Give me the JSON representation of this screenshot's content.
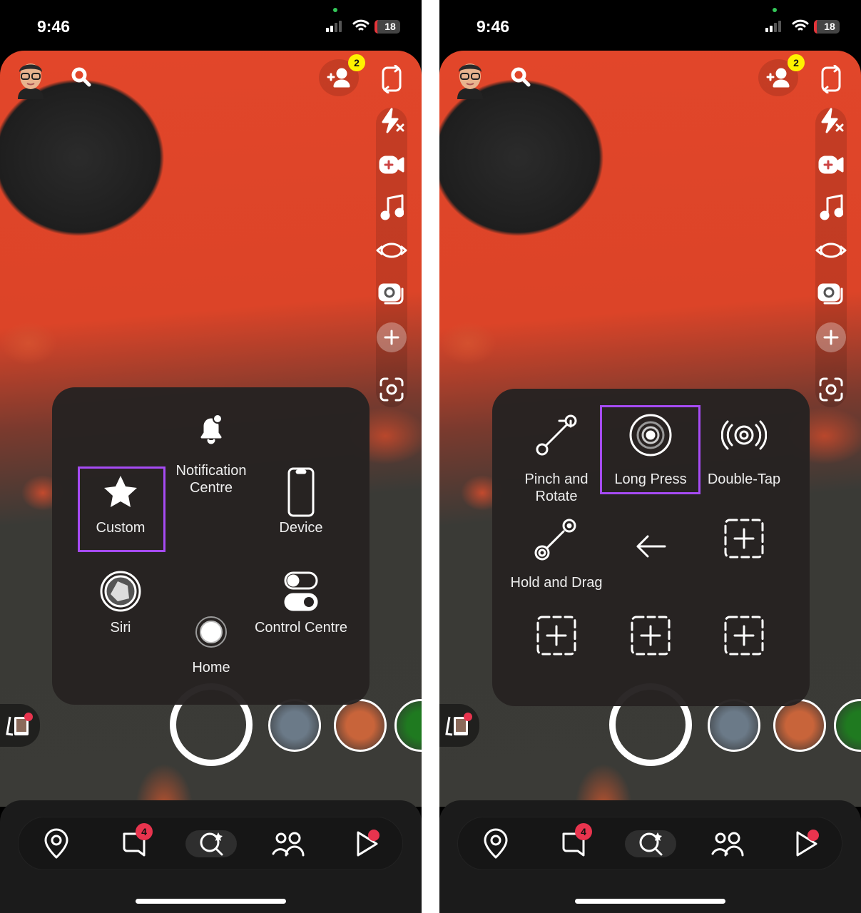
{
  "screens": [
    {
      "status": {
        "time": "9:46",
        "battery": "18"
      },
      "friends_badge": "2",
      "chat_badge": "4",
      "menu": {
        "items": [
          {
            "label": "Notification Centre",
            "icon": "bell-icon"
          },
          {
            "label": "Custom",
            "icon": "star-icon",
            "highlighted": true
          },
          {
            "label": "Device",
            "icon": "phone-device-icon"
          },
          {
            "label": "Siri",
            "icon": "siri-icon"
          },
          {
            "label": "Home",
            "icon": "home-button-icon"
          },
          {
            "label": "Control Centre",
            "icon": "toggles-icon"
          }
        ]
      }
    },
    {
      "status": {
        "time": "9:46",
        "battery": "18"
      },
      "friends_badge": "2",
      "chat_badge": "4",
      "menu": {
        "items": [
          {
            "label": "Pinch and Rotate",
            "icon": "pinch-rotate-icon"
          },
          {
            "label": "Long Press",
            "icon": "long-press-icon",
            "highlighted": true
          },
          {
            "label": "Double-Tap",
            "icon": "double-tap-icon"
          },
          {
            "label": "Hold and Drag",
            "icon": "hold-drag-icon"
          },
          {
            "label": "",
            "icon": "back-arrow-icon"
          },
          {
            "label": "",
            "icon": "add-custom-icon"
          },
          {
            "label": "",
            "icon": "add-custom-icon"
          },
          {
            "label": "",
            "icon": "add-custom-icon"
          },
          {
            "label": "",
            "icon": "add-custom-icon"
          }
        ]
      }
    }
  ],
  "highlight_color": "#a64bf4",
  "badge_colors": {
    "friends": "#fff200",
    "chat": "#e8344e"
  }
}
